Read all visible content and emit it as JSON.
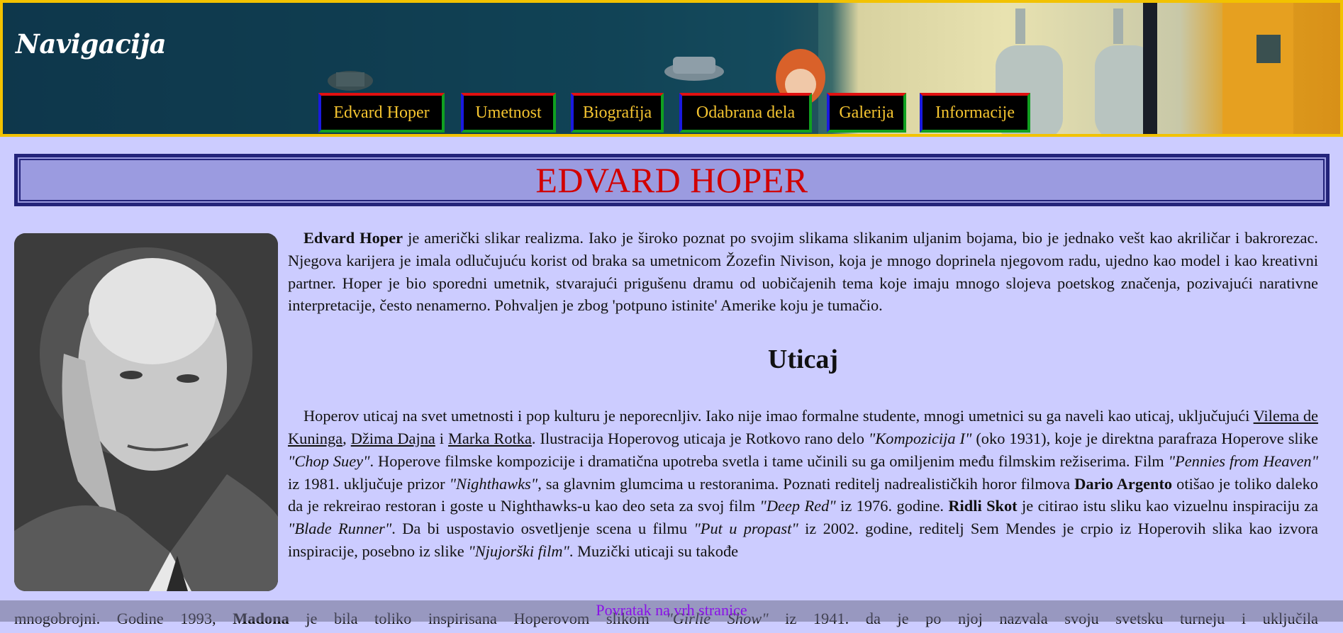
{
  "header": {
    "title": "Navigacija",
    "nav": [
      "Edvard Hoper",
      "Umetnost",
      "Biografija",
      "Odabrana dela",
      "Galerija",
      "Informacije"
    ]
  },
  "main": {
    "title": "EDVARD HOPER",
    "intro_bold": "Edvard Hoper",
    "intro_text": " je američki slikar realizma. Iako je široko poznat po svojim slikama slikanim uljanim bojama, bio je jednako vešt kao akriličar i bakrorezac. Njegova karijera je imala odlučujuću korist od braka sa umetnicom Žozefin Nivison, koja je mnogo doprinela njegovom radu, ujedno kao model i kao kreativni partner. Hoper je bio sporedni umetnik, stvarajući prigušenu dramu od uobičajenih tema koje imaju mnogo slojeva poetskog značenja, pozivajući narativne interpretacije, često nenamerno. Pohvaljen je zbog 'potpuno istinite' Amerike koju je tumačio.",
    "section_heading": "Uticaj",
    "p2": {
      "t1": "Hoperov uticaj na svet umetnosti i pop kulturu je neporecnljiv. Iako nije imao formalne studente, mnogi umetnici su ga naveli kao uticaj, uključujući ",
      "link1": "Vilema de Kuninga",
      "t2": ", ",
      "link2": "Džima Dajna",
      "t3": " i ",
      "link3": "Marka Rotka",
      "t4": ". Ilustracija Hoperovog uticaja je Rotkovo rano delo ",
      "i1": "\"Kompozicija I\"",
      "t5": " (oko 1931), koje je direktna parafraza Hoperove slike ",
      "i2": "\"Chop Suey\"",
      "t6": ". Hoperove filmske kompozicije i dramatična upotreba svetla i tame učinili su ga omiljenim među filmskim režiserima. Film ",
      "i3": "\"Pennies from Heaven\"",
      "t7": " iz 1981. uključuje prizor ",
      "i4": "\"Nighthawks\"",
      "t8": ", sa glavnim glumcima u restoranima. Poznati reditelj nadrealističkih horor filmova ",
      "b1": "Dario Argento",
      "t9": " otišao je toliko daleko da je rekreirao restoran i goste u Nighthawks-u kao deo seta za svoj film ",
      "i5": "\"Deep Red\"",
      "t10": " iz 1976. godine. ",
      "b2": "Ridli Skot",
      "t11": " je citirao istu sliku kao vizuelnu inspiraciju za ",
      "i6": "\"Blade Runner\"",
      "t12": ". Da bi uspostavio osvetljenje scena u filmu ",
      "i7": "\"Put u propast\"",
      "t13": " iz 2002. godine, reditelj Sem Mendes je crpio iz Hoperovih slika kao izvora inspiracije, posebno iz slike ",
      "i8": "\"Njujorški film\"",
      "t14": ". Muzički uticaji su takođe"
    },
    "last_line": {
      "t1": "mnogobrojni. Godine 1993, ",
      "b1": "Madona",
      "t2": " je bila toliko inspirisana Hoperovom slikom ",
      "i1": "\"Girlie Show\"",
      "t3": " iz 1941. da je po njoj nazvala svoju svetsku turneju i uključila"
    }
  },
  "footer": {
    "back_to_top": "Povratak na vrh stranice"
  }
}
